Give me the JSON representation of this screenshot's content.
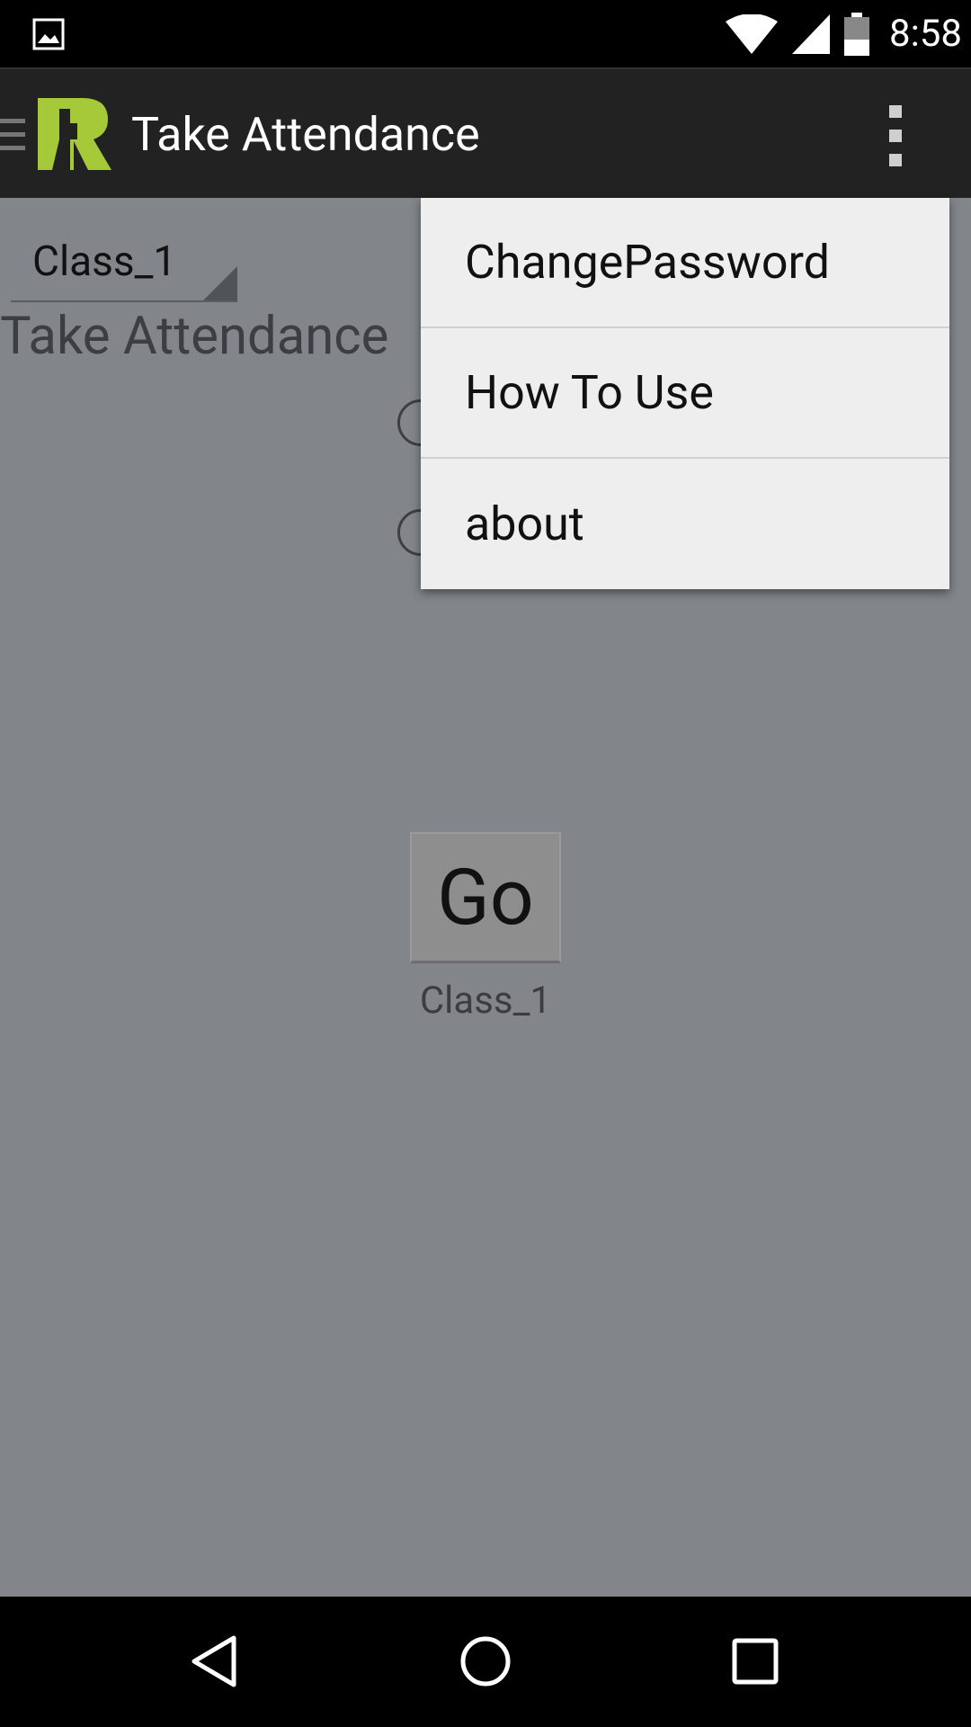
{
  "status_bar": {
    "time": "8:58",
    "icons": [
      "image-notification-icon",
      "wifi-icon",
      "signal-icon",
      "battery-icon"
    ]
  },
  "toolbar": {
    "title": "Take Attendance",
    "logo": "app-logo",
    "navigation_icon": "hamburger-icon",
    "overflow_icon": "overflow-menu-icon"
  },
  "content": {
    "spinner_value": "Class_1",
    "section_title": "Take Attendance",
    "go_button_label": "Go",
    "class_caption": "Class_1"
  },
  "overflow_menu": {
    "items": [
      {
        "label": "ChangePassword"
      },
      {
        "label": "How To Use"
      },
      {
        "label": "about"
      }
    ]
  },
  "nav_bar": {
    "buttons": [
      "back-icon",
      "home-icon",
      "recents-icon"
    ]
  },
  "colors": {
    "toolbar_bg": "#222222",
    "content_dim_bg": "#82868a",
    "menu_bg": "#eeeeee",
    "logo_green": "#a6c93a"
  }
}
